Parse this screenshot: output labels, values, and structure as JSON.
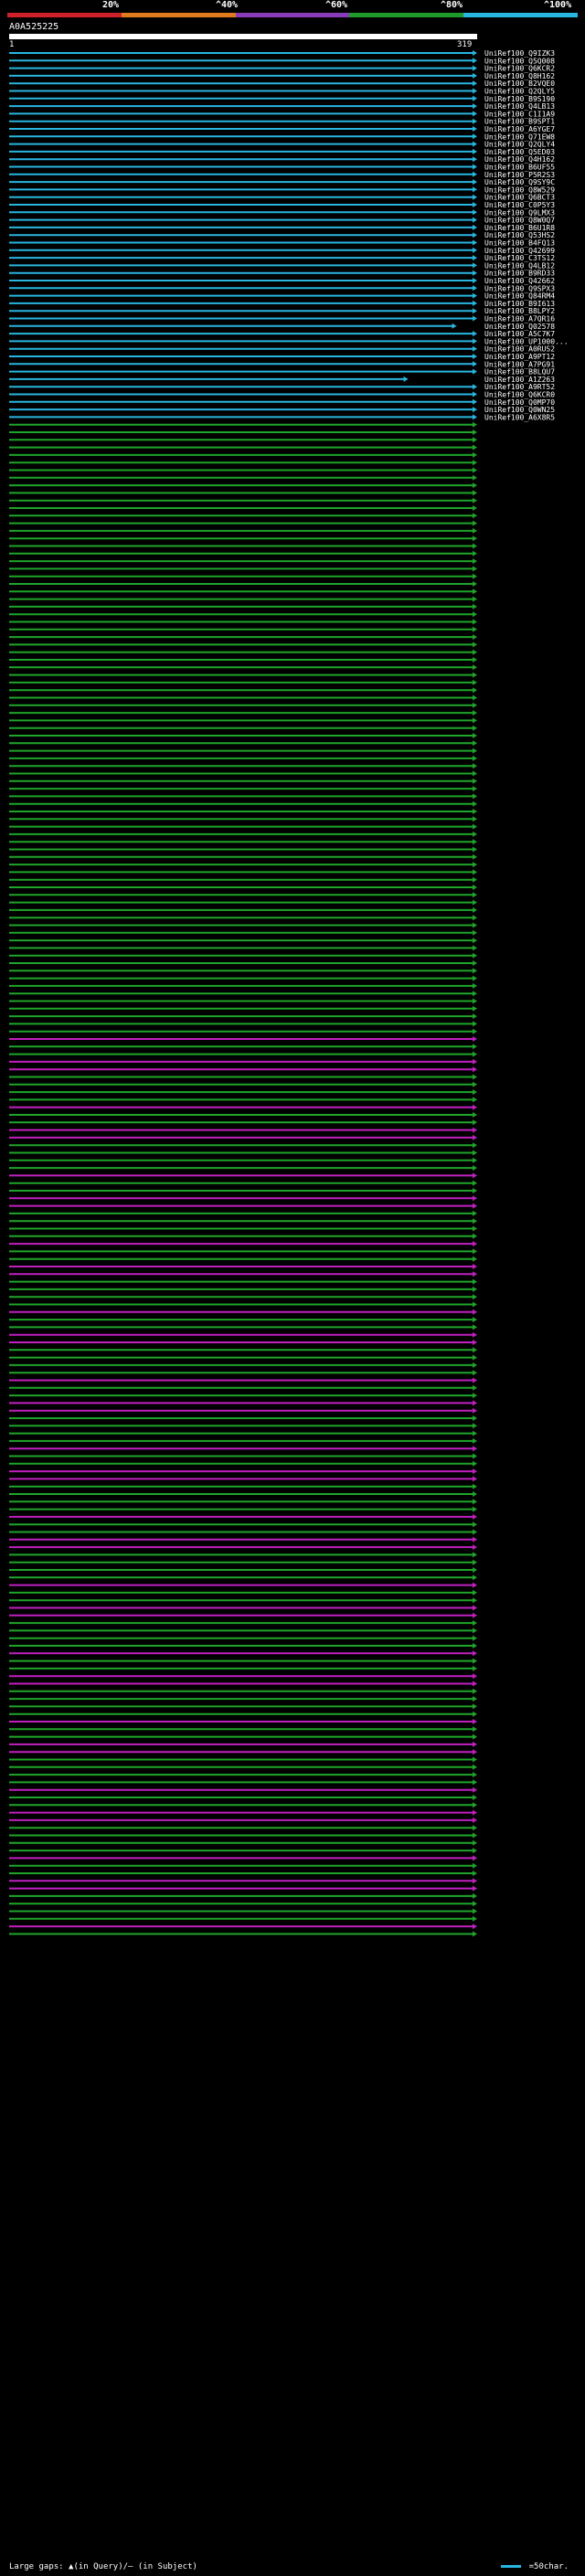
{
  "legend": {
    "colors": [
      "#d0202a",
      "#e07a1f",
      "#8a3cb8",
      "#1f9a2a",
      "#29b6e0"
    ],
    "ticks": [
      "20%",
      "^40%",
      "^60%",
      "^80%",
      "^100%"
    ]
  },
  "query": {
    "id": "A0A525225",
    "start": "1",
    "end": "319"
  },
  "footer": {
    "text": "Large gaps: ▲(in Query)/– (in Subject)",
    "scale": "=50char."
  },
  "chart_data": {
    "type": "alignment-overview",
    "query_length": 319,
    "color_by_identity": {
      "cyan": "90-100%",
      "green": "70-90%",
      "magenta": "50-70%"
    },
    "hits": [
      {
        "id": "UniRef100_Q9IZK3",
        "color": "cyan",
        "end": 319
      },
      {
        "id": "UniRef100_Q5Q008",
        "color": "cyan",
        "end": 319
      },
      {
        "id": "UniRef100_Q6KCR2",
        "color": "cyan",
        "end": 319
      },
      {
        "id": "UniRef100_Q8H162",
        "color": "cyan",
        "end": 319
      },
      {
        "id": "UniRef100_B2VQE0",
        "color": "cyan",
        "end": 319
      },
      {
        "id": "UniRef100_Q2QLY5",
        "color": "cyan",
        "end": 319
      },
      {
        "id": "UniRef100_B9S190",
        "color": "cyan",
        "end": 319
      },
      {
        "id": "UniRef100_Q4LB13",
        "color": "cyan",
        "end": 319
      },
      {
        "id": "UniRef100_C1I1A9",
        "color": "cyan",
        "end": 319
      },
      {
        "id": "UniRef100_B9SPT1",
        "color": "cyan",
        "end": 319
      },
      {
        "id": "UniRef100_A6YGE7",
        "color": "cyan",
        "end": 319
      },
      {
        "id": "UniRef100_Q71EW8",
        "color": "cyan",
        "end": 319
      },
      {
        "id": "UniRef100_Q2QLY4",
        "color": "cyan",
        "end": 319
      },
      {
        "id": "UniRef100_Q5ED03",
        "color": "cyan",
        "end": 319
      },
      {
        "id": "UniRef100_Q4H162",
        "color": "cyan",
        "end": 319
      },
      {
        "id": "UniRef100_B6UF55",
        "color": "cyan",
        "end": 319
      },
      {
        "id": "UniRef100_P5R2S3",
        "color": "cyan",
        "end": 319
      },
      {
        "id": "UniRef100_Q9SY9C",
        "color": "cyan",
        "end": 319
      },
      {
        "id": "UniRef100_Q8W529",
        "color": "cyan",
        "end": 319
      },
      {
        "id": "UniRef100_Q6BCT3",
        "color": "cyan",
        "end": 319
      },
      {
        "id": "UniRef100_C0P5Y3",
        "color": "cyan",
        "end": 319
      },
      {
        "id": "UniRef100_Q9LMX3",
        "color": "cyan",
        "end": 319
      },
      {
        "id": "UniRef100_Q8W0Q7",
        "color": "cyan",
        "end": 319
      },
      {
        "id": "UniRef100_B6U1R8",
        "color": "cyan",
        "end": 319
      },
      {
        "id": "UniRef100_Q53HS2",
        "color": "cyan",
        "end": 319
      },
      {
        "id": "UniRef100_B4FQ13",
        "color": "cyan",
        "end": 319
      },
      {
        "id": "UniRef100_Q42699",
        "color": "cyan",
        "end": 319
      },
      {
        "id": "UniRef100_C3TS12",
        "color": "cyan",
        "end": 319
      },
      {
        "id": "UniRef100_Q4LB12",
        "color": "cyan",
        "end": 319
      },
      {
        "id": "UniRef100_B9RD33",
        "color": "cyan",
        "end": 319
      },
      {
        "id": "UniRef100_Q42662",
        "color": "cyan",
        "end": 319
      },
      {
        "id": "UniRef100_Q9SPX3",
        "color": "cyan",
        "end": 319
      },
      {
        "id": "UniRef100_Q84RM4",
        "color": "cyan",
        "end": 319
      },
      {
        "id": "UniRef100_B9I613",
        "color": "cyan",
        "end": 319
      },
      {
        "id": "UniRef100_B8LPY2",
        "color": "cyan",
        "end": 319
      },
      {
        "id": "UniRef100_A7QR16",
        "color": "cyan",
        "end": 319
      },
      {
        "id": "UniRef100_Q02578",
        "color": "cyan",
        "end": 305
      },
      {
        "id": "UniRef100_A5C7K7",
        "color": "cyan",
        "end": 319
      },
      {
        "id": "UniRef100_UP1000...",
        "color": "cyan",
        "end": 319
      },
      {
        "id": "UniRef100_A0RUS2",
        "color": "cyan",
        "end": 319
      },
      {
        "id": "UniRef100_A9PT12",
        "color": "cyan",
        "end": 319
      },
      {
        "id": "UniRef100_A7PG91",
        "color": "cyan",
        "end": 319
      },
      {
        "id": "UniRef100_B8LQU7",
        "color": "cyan",
        "end": 319
      },
      {
        "id": "UniRef100_A1Z263",
        "color": "cyan",
        "end": 272
      },
      {
        "id": "UniRef100_A9RT52",
        "color": "cyan",
        "end": 319
      },
      {
        "id": "UniRef100_Q6KCR0",
        "color": "cyan",
        "end": 319
      },
      {
        "id": "UniRef100_Q0MP70",
        "color": "cyan",
        "end": 319
      },
      {
        "id": "UniRef100_Q0WN25",
        "color": "cyan",
        "end": 319
      },
      {
        "id": "UniRef100_A6X8R5",
        "color": "cyan",
        "end": 319
      }
    ],
    "green_count": 78,
    "mixed_count": 122
  }
}
